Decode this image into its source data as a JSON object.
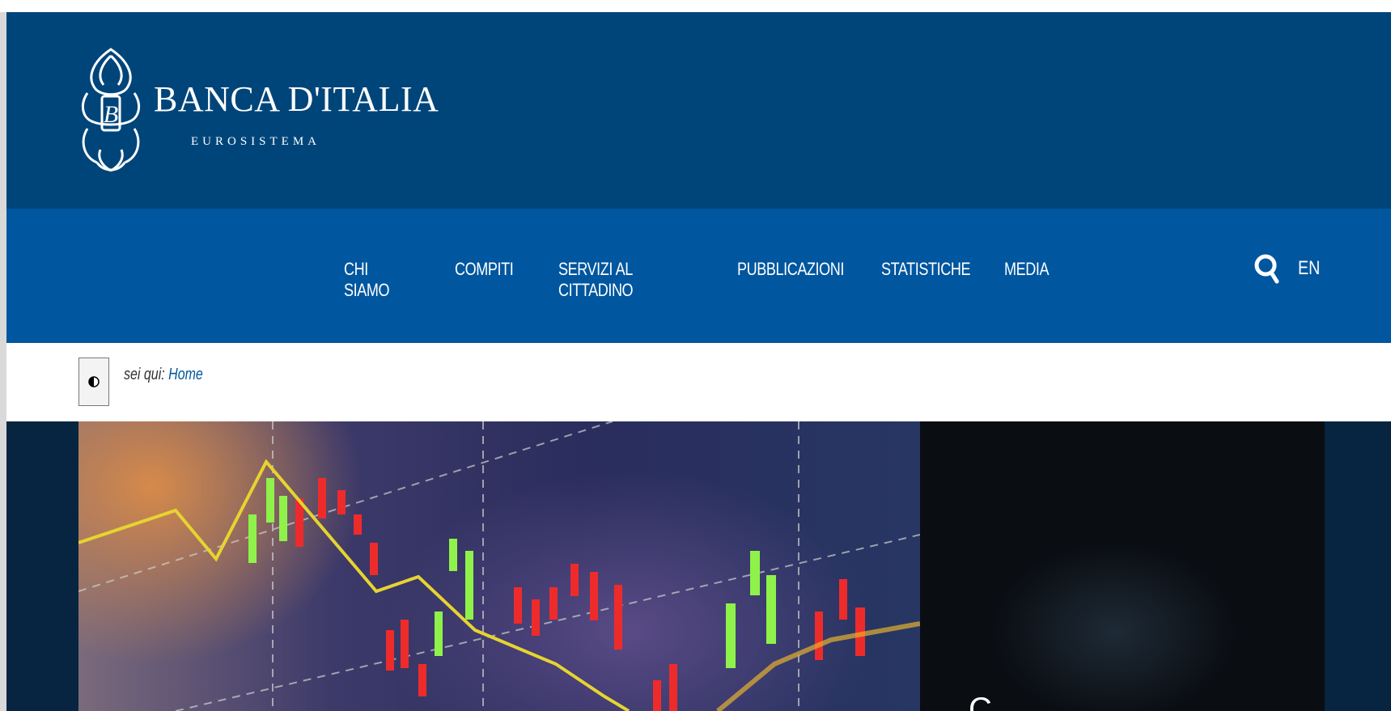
{
  "brand": {
    "name": "BANCA D'ITALIA",
    "subtitle": "EUROSISTEMA",
    "icon": "banca-italia-logo-mark"
  },
  "nav": {
    "items": [
      "CHI SIAMO",
      "COMPITI",
      "SERVIZI AL CITTADINO",
      "PUBBLICAZIONI",
      "STATISTICHE",
      "MEDIA"
    ],
    "search_icon": "search-icon",
    "language": "EN"
  },
  "breadcrumb": {
    "label": "sei qui:",
    "current": "Home",
    "contrast_icon": "contrast-icon"
  },
  "hero": {
    "image": "stock-candlestick-chart-photo",
    "side_title": "C"
  },
  "colors": {
    "header_dark": "#00457a",
    "nav_blue": "#00569f",
    "hero_bg": "#072540",
    "link": "#00569f"
  }
}
